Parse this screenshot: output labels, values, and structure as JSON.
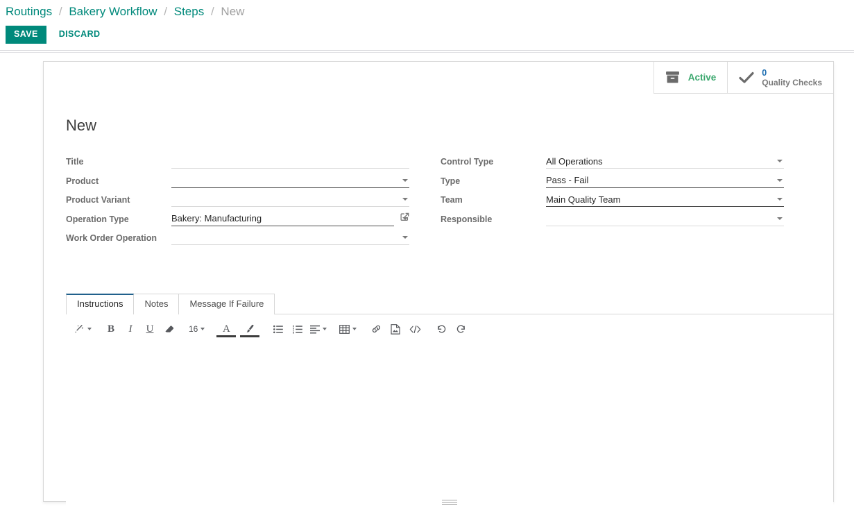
{
  "breadcrumb": {
    "items": [
      {
        "label": "Routings",
        "active": false
      },
      {
        "label": "Bakery Workflow",
        "active": false
      },
      {
        "label": "Steps",
        "active": false
      },
      {
        "label": "New",
        "active": true
      }
    ],
    "separator": "/"
  },
  "actions": {
    "save_label": "SAVE",
    "discard_label": "DISCARD",
    "save_bg": "#00897b",
    "discard_color": "#00897b"
  },
  "stat_buttons": [
    {
      "icon": "archive-box-icon",
      "label": "Active",
      "value": "",
      "label_color": "#3aa76d"
    },
    {
      "icon": "check-icon",
      "label": "Quality Checks",
      "value": "0",
      "value_color": "#1f6fb2"
    }
  ],
  "record": {
    "title": "New"
  },
  "form": {
    "left_fields": [
      {
        "label": "Title",
        "value": "",
        "widget": "text",
        "underline": "light"
      },
      {
        "label": "Product",
        "value": "",
        "widget": "select",
        "underline": "strong"
      },
      {
        "label": "Product Variant",
        "value": "",
        "widget": "select",
        "underline": "light"
      },
      {
        "label": "Operation Type",
        "value": "Bakery: Manufacturing",
        "widget": "select",
        "underline": "strong",
        "external_link": true
      },
      {
        "label": "Work Order Operation",
        "value": "",
        "widget": "select",
        "underline": "light"
      }
    ],
    "right_fields": [
      {
        "label": "Control Type",
        "value": "All Operations",
        "widget": "select",
        "underline": "light"
      },
      {
        "label": "Type",
        "value": "Pass - Fail",
        "widget": "select",
        "underline": "strong"
      },
      {
        "label": "Team",
        "value": "Main Quality Team",
        "widget": "select",
        "underline": "strong"
      },
      {
        "label": "Responsible",
        "value": "",
        "widget": "select",
        "underline": "light"
      }
    ]
  },
  "notebook": {
    "tabs": [
      {
        "label": "Instructions",
        "active": true
      },
      {
        "label": "Notes",
        "active": false
      },
      {
        "label": "Message If Failure",
        "active": false
      }
    ]
  },
  "editor": {
    "toolbar": [
      {
        "name": "style-wand-icon",
        "glyph": "wand",
        "caret": true
      },
      {
        "name": "bold-button",
        "glyph": "B"
      },
      {
        "name": "italic-button",
        "glyph": "I"
      },
      {
        "name": "underline-button",
        "glyph": "U"
      },
      {
        "name": "remove-format-icon",
        "glyph": "eraser"
      },
      {
        "name": "font-size-select",
        "glyph": "16",
        "caret": true
      },
      {
        "name": "font-color-icon",
        "glyph": "A",
        "colorbar": true
      },
      {
        "name": "background-color-icon",
        "glyph": "brush",
        "colorbar": true
      },
      {
        "name": "unordered-list-icon",
        "glyph": "ul"
      },
      {
        "name": "ordered-list-icon",
        "glyph": "ol"
      },
      {
        "name": "align-icon",
        "glyph": "align",
        "caret": true
      },
      {
        "name": "table-icon",
        "glyph": "table",
        "caret": true
      },
      {
        "name": "link-icon",
        "glyph": "link"
      },
      {
        "name": "image-icon",
        "glyph": "image"
      },
      {
        "name": "code-icon",
        "glyph": "code"
      },
      {
        "name": "undo-icon",
        "glyph": "undo"
      },
      {
        "name": "redo-icon",
        "glyph": "redo"
      }
    ],
    "content": "",
    "font_size": "16"
  }
}
